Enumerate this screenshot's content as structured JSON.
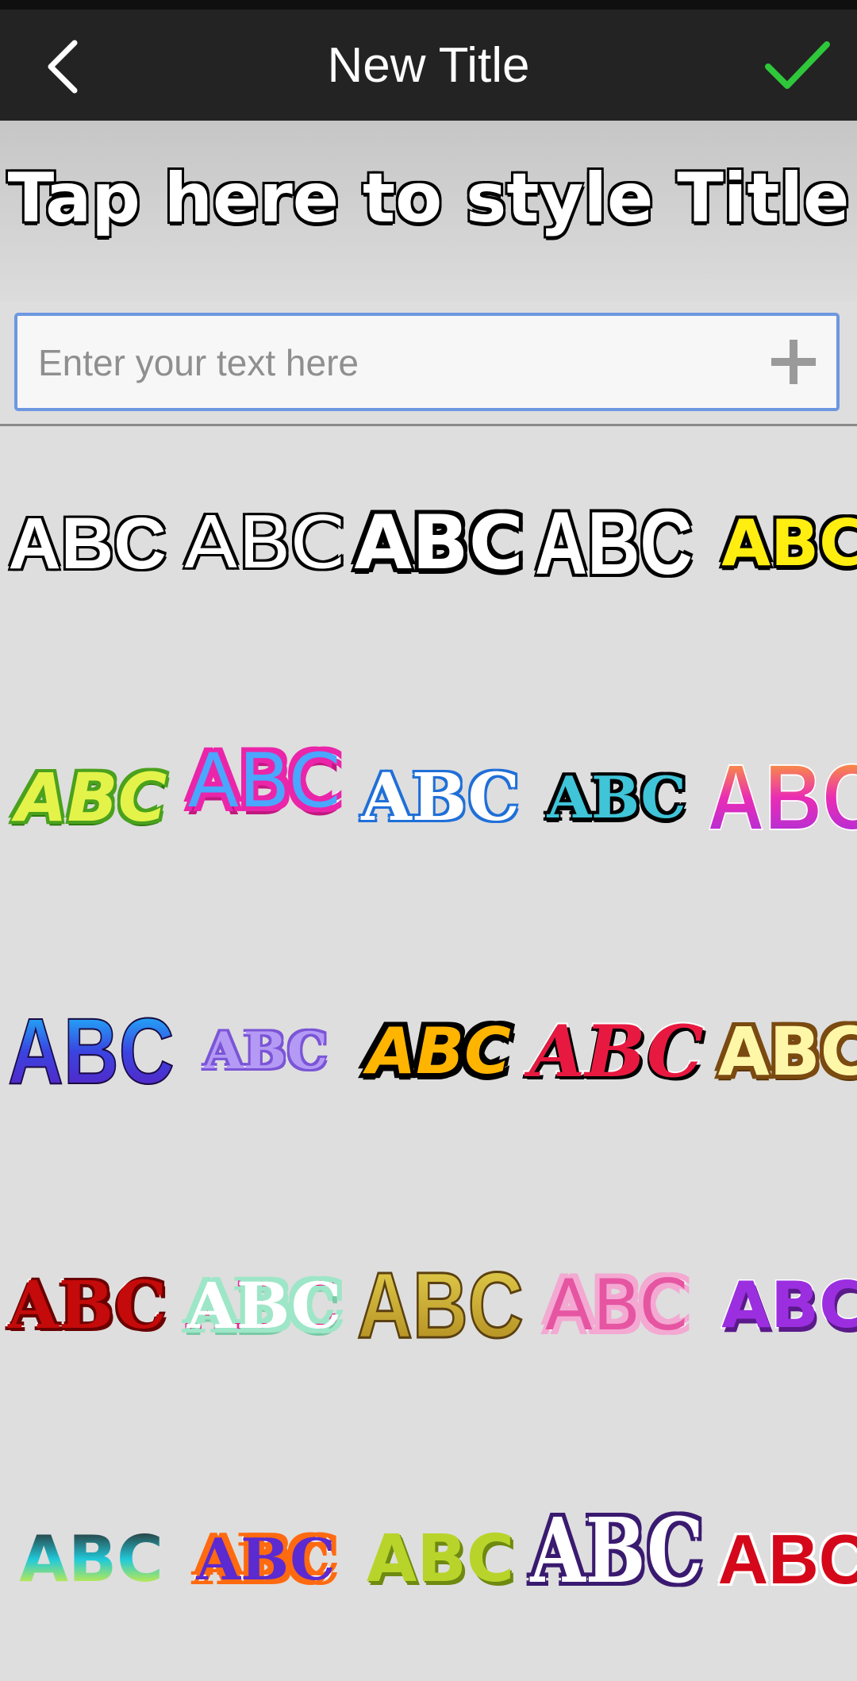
{
  "header": {
    "title": "New Title",
    "back_icon": "chevron-left-icon",
    "confirm_icon": "checkmark-icon",
    "confirm_color": "#2ec83a"
  },
  "preview": {
    "text": "Tap here to style Title"
  },
  "input": {
    "value": "",
    "placeholder": "Enter your text here",
    "add_icon": "plus-icon"
  },
  "styles": {
    "sample_text": "ABC",
    "rows": [
      [
        "white-black-outline",
        "white-thin-outline",
        "white-bold-black",
        "white-condensed",
        "yellow-black-outline"
      ],
      [
        "lime-green",
        "blue-pink-outline",
        "white-blue-outline",
        "cyan-black-outline",
        "pink-purple-gradient"
      ],
      [
        "blue-purple-gradient",
        "lavender-purple",
        "yellow-orange-black",
        "red-white-outline",
        "cream-brown"
      ],
      [
        "red-white-gothic",
        "pink-mint-outline",
        "gold-brown",
        "pink-white-outline",
        "purple-white"
      ],
      [
        "cyan-yellow-gradient",
        "purple-orange-outline",
        "olive-green",
        "white-purple-gothic",
        "red-white"
      ]
    ]
  }
}
